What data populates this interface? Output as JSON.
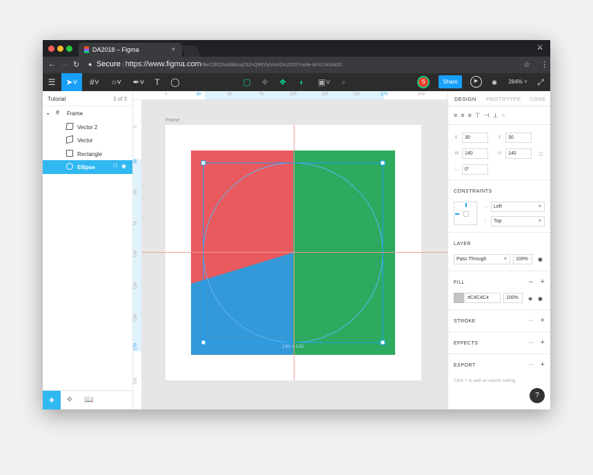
{
  "browser": {
    "tab_title": "DA2018 – Figma",
    "tab_close": "×",
    "secure_label": "Secure",
    "url_host": "https://www.figma.com",
    "url_path": "/file/CBO2vsMBkzaZ62nQ991fyhms/DA2018?node-id=61%3A831"
  },
  "toolbar": {
    "avatar_initial": "S",
    "share_label": "Share",
    "zoom_label": "284%"
  },
  "layers_panel": {
    "page_name": "Tutorial",
    "page_count": "3 of 3",
    "items": [
      {
        "label": "Frame",
        "icon": "frame-icon"
      },
      {
        "label": "Vector 2",
        "icon": "vector-icon"
      },
      {
        "label": "Vector",
        "icon": "vector-icon"
      },
      {
        "label": "Rectangle",
        "icon": "rectangle-icon"
      },
      {
        "label": "Ellipse",
        "icon": "ellipse-icon",
        "selected": true
      }
    ]
  },
  "rulers": {
    "top": [
      "0",
      "30",
      "50",
      "75",
      "100",
      "125",
      "150",
      "170",
      "200"
    ],
    "left": [
      "0",
      "30",
      "50",
      "75",
      "100",
      "125",
      "150",
      "170",
      "200"
    ]
  },
  "canvas": {
    "frame_label": "Frame",
    "dimension_label": "140 × 140",
    "colors": {
      "red": "#e95a5f",
      "green": "#2daa5f",
      "blue": "#3499d8",
      "selection": "#18a0fb"
    }
  },
  "properties": {
    "tabs": [
      "DESIGN",
      "PROTOTYPE",
      "CODE"
    ],
    "x_label": "X",
    "x_value": "30",
    "y_label": "Y",
    "y_value": "30",
    "w_label": "W",
    "w_value": "140",
    "h_label": "H",
    "h_value": "140",
    "rotation_value": "0°",
    "constraints_title": "CONSTRAINTS",
    "constraint_h": "Left",
    "constraint_v": "Top",
    "layer_title": "LAYER",
    "blend_mode": "Pass Through",
    "layer_opacity": "100%",
    "fill_title": "FILL",
    "fill_hex": "#C4C4C4",
    "fill_opacity": "100%",
    "stroke_title": "STROKE",
    "effects_title": "EFFECTS",
    "export_title": "EXPORT",
    "export_hint": "Click + to add an export setting",
    "help_label": "?"
  }
}
